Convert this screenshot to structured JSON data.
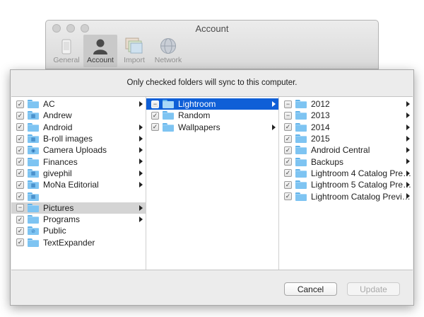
{
  "window": {
    "title": "Account",
    "toolbar": [
      {
        "label": "General",
        "icon": "phone-icon",
        "active": false
      },
      {
        "label": "Account",
        "icon": "person-icon",
        "active": true
      },
      {
        "label": "Import",
        "icon": "photos-icon",
        "active": false
      },
      {
        "label": "Network",
        "icon": "globe-icon",
        "active": false
      }
    ]
  },
  "sheet": {
    "message": "Only checked folders will sync to this computer.",
    "columns": [
      [
        {
          "label": "AC",
          "check": "checked",
          "glyph": "",
          "arrow": true,
          "sel": ""
        },
        {
          "label": "Andrew",
          "check": "checked",
          "glyph": "grid",
          "arrow": false,
          "sel": ""
        },
        {
          "label": "Android",
          "check": "checked",
          "glyph": "",
          "arrow": true,
          "sel": ""
        },
        {
          "label": "B-roll images",
          "check": "checked",
          "glyph": "grid",
          "arrow": true,
          "sel": ""
        },
        {
          "label": "Camera Uploads",
          "check": "checked",
          "glyph": "camera",
          "arrow": true,
          "sel": ""
        },
        {
          "label": "Finances",
          "check": "checked",
          "glyph": "",
          "arrow": true,
          "sel": ""
        },
        {
          "label": "givephil",
          "check": "checked",
          "glyph": "grid",
          "arrow": true,
          "sel": ""
        },
        {
          "label": "MoNa Editorial",
          "check": "checked",
          "glyph": "grid",
          "arrow": true,
          "sel": ""
        },
        {
          "label": "",
          "check": "checked",
          "glyph": "grid",
          "arrow": false,
          "sel": ""
        },
        {
          "label": "Pictures",
          "check": "mixed",
          "glyph": "",
          "arrow": true,
          "sel": "grey"
        },
        {
          "label": "Programs",
          "check": "checked",
          "glyph": "",
          "arrow": true,
          "sel": ""
        },
        {
          "label": "Public",
          "check": "checked",
          "glyph": "public",
          "arrow": false,
          "sel": ""
        },
        {
          "label": "TextExpander",
          "check": "checked",
          "glyph": "",
          "arrow": false,
          "sel": ""
        }
      ],
      [
        {
          "label": "Lightroom",
          "check": "mixed",
          "glyph": "",
          "arrow": true,
          "sel": "blue"
        },
        {
          "label": "Random",
          "check": "checked",
          "glyph": "",
          "arrow": false,
          "sel": ""
        },
        {
          "label": "Wallpapers",
          "check": "checked",
          "glyph": "",
          "arrow": true,
          "sel": ""
        }
      ],
      [
        {
          "label": "2012",
          "check": "mixed",
          "glyph": "",
          "arrow": true,
          "sel": ""
        },
        {
          "label": "2013",
          "check": "mixed",
          "glyph": "",
          "arrow": true,
          "sel": ""
        },
        {
          "label": "2014",
          "check": "checked",
          "glyph": "",
          "arrow": true,
          "sel": ""
        },
        {
          "label": "2015",
          "check": "checked",
          "glyph": "",
          "arrow": true,
          "sel": ""
        },
        {
          "label": "Android Central",
          "check": "checked",
          "glyph": "",
          "arrow": true,
          "sel": ""
        },
        {
          "label": "Backups",
          "check": "checked",
          "glyph": "",
          "arrow": true,
          "sel": ""
        },
        {
          "label": "Lightroom 4 Catalog Pre…",
          "check": "checked",
          "glyph": "",
          "arrow": true,
          "sel": ""
        },
        {
          "label": "Lightroom 5 Catalog Pre…",
          "check": "checked",
          "glyph": "",
          "arrow": true,
          "sel": ""
        },
        {
          "label": "Lightroom Catalog Previ…",
          "check": "checked",
          "glyph": "",
          "arrow": true,
          "sel": ""
        }
      ]
    ],
    "cancel_label": "Cancel",
    "update_label": "Update",
    "update_enabled": false
  },
  "colors": {
    "selection_blue": "#0f5fd7",
    "selection_grey": "#d4d4d4",
    "folder_blue": "#7ec4f2"
  }
}
